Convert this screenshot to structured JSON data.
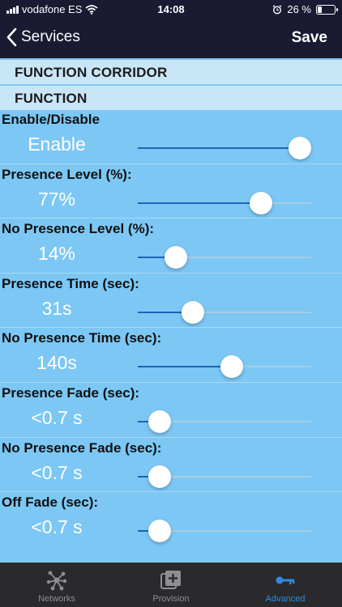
{
  "status_bar": {
    "carrier": "vodafone ES",
    "time": "14:08",
    "battery_text": "26 %",
    "battery_level": 0.26
  },
  "nav": {
    "back_label": "Services",
    "save_label": "Save"
  },
  "sections": {
    "corridor": "FUNCTION CORRIDOR",
    "function": "FUNCTION"
  },
  "settings": [
    {
      "label": "Enable/Disable",
      "value": "Enable",
      "level": 1.0
    },
    {
      "label": "Presence Level (%):",
      "value": "77%",
      "level": 0.74
    },
    {
      "label": "No Presence Level (%):",
      "value": "14%",
      "level": 0.18
    },
    {
      "label": "Presence Time (sec):",
      "value": "31s",
      "level": 0.29
    },
    {
      "label": "No Presence Time (sec):",
      "value": "140s",
      "level": 0.55
    },
    {
      "label": "Presence Fade (sec):",
      "value": "<0.7 s",
      "level": 0.07
    },
    {
      "label": "No Presence Fade (sec):",
      "value": "<0.7 s",
      "level": 0.07
    },
    {
      "label": "Off Fade (sec):",
      "value": "<0.7 s",
      "level": 0.07
    }
  ],
  "tabs": [
    {
      "label": "Networks",
      "icon": "network-nodes-icon",
      "active": false
    },
    {
      "label": "Provision",
      "icon": "add-square-icon",
      "active": false
    },
    {
      "label": "Advanced",
      "icon": "key-icon",
      "active": true
    }
  ],
  "colors": {
    "nav_background": "#1b1a33",
    "content_background": "#7cc7f4",
    "section_header": "#c8e6f5",
    "slider_fill": "#1d63b8",
    "tab_active": "#2f8be0",
    "tab_inactive": "#8e8e93"
  }
}
